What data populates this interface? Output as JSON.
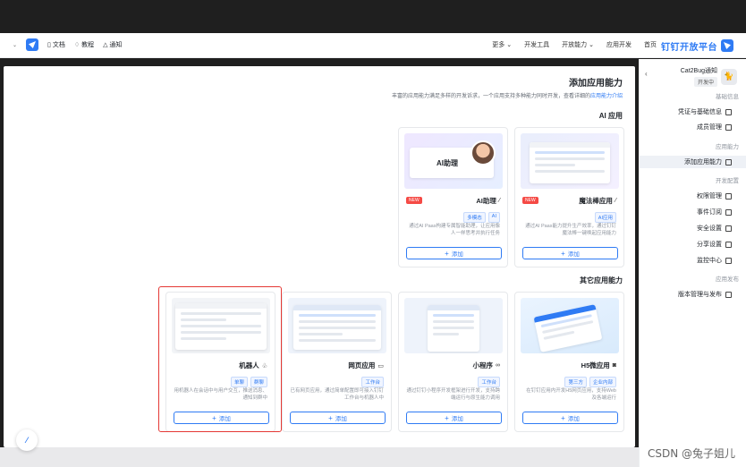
{
  "nav": {
    "brand": "钉钉开放平台",
    "menu": [
      "首页",
      "应用开发",
      "开放能力",
      "开发工具",
      "更多"
    ],
    "left_links": [
      "文档",
      "教程",
      "通知"
    ]
  },
  "sidebar": {
    "app_name": "Cat2Bug通知",
    "app_tag": "开发中",
    "sections": {
      "basic": "基础信息",
      "app_ability": "应用能力",
      "dev_config": "开发配置",
      "publish": "应用发布"
    },
    "items": {
      "credentials": "凭证与基础信息",
      "members": "成员管理",
      "add_ability": "添加应用能力",
      "permissions": "权限管理",
      "events": "事件订阅",
      "security": "安全设置",
      "share": "分享设置",
      "monitor": "监控中心",
      "version": "版本管理与发布"
    }
  },
  "main": {
    "title": "添加应用能力",
    "desc": "丰富的应用能力满足多样的开发诉求，一个应用支持多种能力同时开发，查看详细的",
    "desc_link": "应用能力介绍",
    "ai_group": "AI 应用",
    "other_group": "其它应用能力",
    "add_label": "添加"
  },
  "cards": {
    "magic": {
      "name": "魔法棒应用",
      "tag": "AI应用",
      "badge": "NEW",
      "desc": "通过AI Paas能力提升生产效率，通过钉钉魔法棒一键唤起应用能力"
    },
    "assistant": {
      "name": "AI助理",
      "tags": [
        "AI",
        "多模态"
      ],
      "badge": "NEW",
      "desc": "通过AI Paas构建专属智能助理，让应用像人一样思考并执行任务",
      "thumb_title": "AI助理"
    },
    "h5": {
      "name": "H5微应用",
      "tags": [
        "企业内部",
        "第三方"
      ],
      "desc": "在钉钉应用内开发H5网页应用，支持Web及各端运行"
    },
    "mini": {
      "name": "小程序",
      "tags": [
        "工作台"
      ],
      "desc": "通过钉钉小程序开发框架进行开发，支持跨端运行与原生能力调用"
    },
    "web": {
      "name": "网页应用",
      "tags": [
        "工作台"
      ],
      "desc": "已有网页应用，通过简单配置即可接入钉钉工作台与机器人中"
    },
    "robot": {
      "name": "机器人",
      "tags": [
        "群聊",
        "单聊"
      ],
      "desc": "用机器人在会话中与用户交互，推送消息、通知到群中"
    }
  },
  "watermark": "CSDN @兔子姐儿"
}
